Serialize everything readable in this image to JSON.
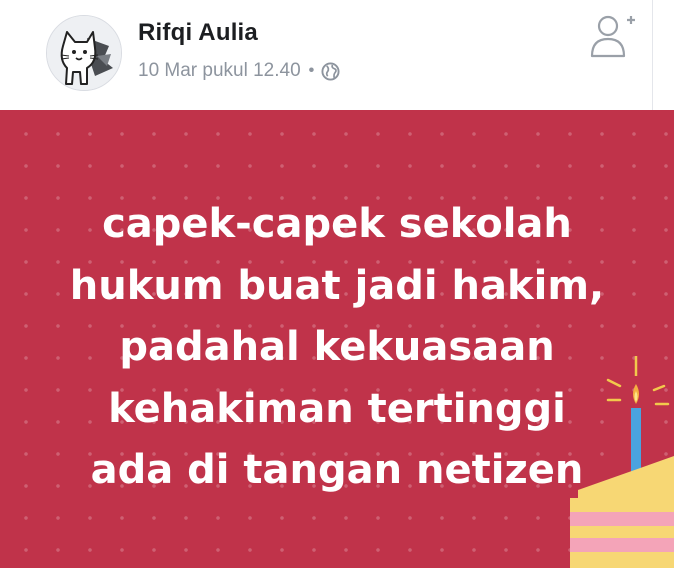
{
  "post": {
    "author": {
      "name": "Rifqi Aulia",
      "avatar_icon": "cat-cartoon-avatar"
    },
    "meta": {
      "date": "10 Mar pukul 12.40",
      "separator": "•",
      "privacy_icon": "globe-icon"
    },
    "add_friend_icon": "add-friend-icon",
    "background_color": "#c0334a",
    "text_lines": [
      "capek-capek sekolah",
      "hukum buat jadi hakim,",
      "padahal kekuasaan",
      "kehakiman tertinggi",
      "ada di tangan netizen"
    ],
    "decoration_icon": "birthday-cake-candle-icon"
  }
}
